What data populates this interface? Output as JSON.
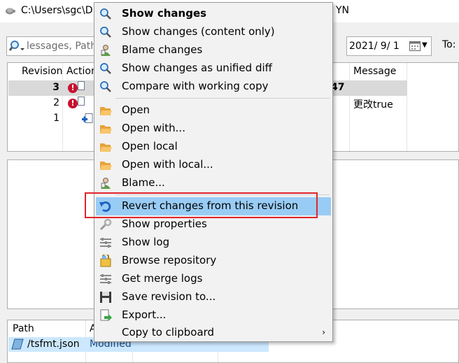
{
  "window": {
    "title": "C:\\Users\\sgc\\D",
    "title_tail": "YN"
  },
  "filter": {
    "search_placeholder": "lessages, Path",
    "date_value": "2021/  9/  1",
    "to_label": "To:"
  },
  "revision_list": {
    "columns": [
      "Revision",
      "Action",
      "Message"
    ],
    "rows": [
      {
        "revision": "3",
        "message": "",
        "fragment": "47"
      },
      {
        "revision": "2",
        "message": "更改true"
      },
      {
        "revision": "1",
        "message": ""
      }
    ]
  },
  "path_list": {
    "columns": [
      "Path",
      "A"
    ],
    "rows": [
      {
        "path": "/tsfmt.json",
        "action": "Modified"
      }
    ]
  },
  "context_menu": {
    "items": [
      {
        "label": "Show changes",
        "icon": "magnifier-icon",
        "bold": true
      },
      {
        "label": "Show changes (content only)",
        "icon": "magnifier-icon"
      },
      {
        "label": "Blame changes",
        "icon": "blame-person-icon"
      },
      {
        "label": "Show changes as unified diff",
        "icon": "magnifier-icon"
      },
      {
        "label": "Compare with working copy",
        "icon": "magnifier-icon"
      },
      {
        "label": "Open",
        "icon": "folder-open-icon"
      },
      {
        "label": "Open with...",
        "icon": "folder-open-icon"
      },
      {
        "label": "Open local",
        "icon": "folder-open-icon"
      },
      {
        "label": "Open with local...",
        "icon": "folder-open-icon"
      },
      {
        "label": "Blame...",
        "icon": "blame-person-icon"
      },
      {
        "label": "Revert changes from this revision",
        "icon": "undo-arrow-icon",
        "highlighted": true
      },
      {
        "label": "Show properties",
        "icon": "wrench-icon"
      },
      {
        "label": "Show log",
        "icon": "log-lines-icon"
      },
      {
        "label": "Browse repository",
        "icon": "repository-icon"
      },
      {
        "label": "Get merge logs",
        "icon": "log-lines-icon"
      },
      {
        "label": "Save revision to...",
        "icon": "floppy-disk-icon"
      },
      {
        "label": "Export...",
        "icon": "export-icon"
      },
      {
        "label": "Copy to clipboard",
        "icon": "none",
        "submenu": true
      }
    ]
  },
  "colors": {
    "highlight": "#99ccf5",
    "annotation_box": "#e0252c",
    "selected_row": "#d9d9d9",
    "path_row": "#cce8ff"
  }
}
